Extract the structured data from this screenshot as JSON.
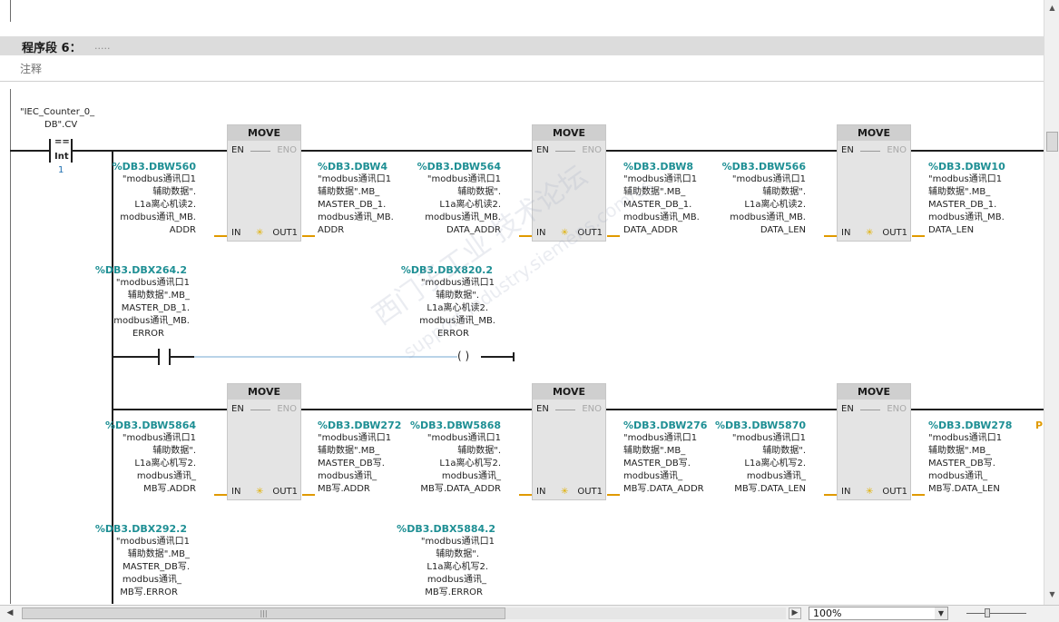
{
  "segment": {
    "title": "程序段 6：",
    "dots": ".....",
    "comment": "注释"
  },
  "contact": {
    "tag_line1": "\"IEC_Counter_0_",
    "tag_line2": "DB\".CV",
    "op": "==",
    "type": "Int",
    "value": "1"
  },
  "move_label": "MOVE",
  "pins": {
    "en": "EN",
    "eno": "ENO",
    "in": "IN",
    "out": "OUT1"
  },
  "row1": [
    {
      "in_addr": "%DB3.DBW560",
      "in_lines": [
        "\"modbus通讯口1",
        "辅助数据\".",
        "L1a离心机读2.",
        "modbus通讯_MB.",
        "ADDR"
      ],
      "out_addr": "%DB3.DBW4",
      "out_lines": [
        "\"modbus通讯口1",
        "辅助数据\".MB_",
        "MASTER_DB_1.",
        "modbus通讯_MB.",
        "ADDR"
      ]
    },
    {
      "in_addr": "%DB3.DBW564",
      "in_lines": [
        "\"modbus通讯口1",
        "辅助数据\".",
        "L1a离心机读2.",
        "modbus通讯_MB.",
        "DATA_ADDR"
      ],
      "out_addr": "%DB3.DBW8",
      "out_lines": [
        "\"modbus通讯口1",
        "辅助数据\".MB_",
        "MASTER_DB_1.",
        "modbus通讯_MB.",
        "DATA_ADDR"
      ]
    },
    {
      "in_addr": "%DB3.DBW566",
      "in_lines": [
        "\"modbus通讯口1",
        "辅助数据\".",
        "L1a离心机读2.",
        "modbus通讯_MB.",
        "DATA_LEN"
      ],
      "out_addr": "%DB3.DBW10",
      "out_lines": [
        "\"modbus通讯口1",
        "辅助数据\".MB_",
        "MASTER_DB_1.",
        "modbus通讯_MB.",
        "DATA_LEN"
      ]
    }
  ],
  "coil_row": {
    "contact_addr": "%DB3.DBX264.2",
    "contact_lines": [
      "\"modbus通讯口1",
      "辅助数据\".MB_",
      "MASTER_DB_1.",
      "modbus通讯_MB.",
      "ERROR"
    ],
    "coil_addr": "%DB3.DBX820.2",
    "coil_lines": [
      "\"modbus通讯口1",
      "辅助数据\".",
      "L1a离心机读2.",
      "modbus通讯_MB.",
      "ERROR"
    ]
  },
  "row2": [
    {
      "in_addr": "%DB3.DBW5864",
      "in_lines": [
        "\"modbus通讯口1",
        "辅助数据\".",
        "L1a离心机写2.",
        "modbus通讯_",
        "MB写.ADDR"
      ],
      "out_addr": "%DB3.DBW272",
      "out_lines": [
        "\"modbus通讯口1",
        "辅助数据\".MB_",
        "MASTER_DB写.",
        "modbus通讯_",
        "MB写.ADDR"
      ]
    },
    {
      "in_addr": "%DB3.DBW5868",
      "in_lines": [
        "\"modbus通讯口1",
        "辅助数据\".",
        "L1a离心机写2.",
        "modbus通讯_",
        "MB写.DATA_ADDR"
      ],
      "out_addr": "%DB3.DBW276",
      "out_lines": [
        "\"modbus通讯口1",
        "辅助数据\".MB_",
        "MASTER_DB写.",
        "modbus通讯_",
        "MB写.DATA_ADDR"
      ]
    },
    {
      "in_addr": "%DB3.DBW5870",
      "in_lines": [
        "\"modbus通讯口1",
        "辅助数据\".",
        "L1a离心机写2.",
        "modbus通讯_",
        "MB写.DATA_LEN"
      ],
      "out_addr": "%DB3.DBW278",
      "out_lines": [
        "\"modbus通讯口1",
        "辅助数据\".MB_",
        "MASTER_DB写.",
        "modbus通讯_",
        "MB写.DATA_LEN"
      ]
    }
  ],
  "row3": {
    "contact_addr": "%DB3.DBX292.2",
    "contact_lines": [
      "\"modbus通讯口1",
      "辅助数据\".MB_",
      "MASTER_DB写.",
      "modbus通讯_",
      "MB写.ERROR"
    ],
    "coil_addr": "%DB3.DBX5884.2",
    "coil_lines": [
      "\"modbus通讯口1",
      "辅助数据\".",
      "L1a离心机写2.",
      "modbus通讯_",
      "MB写.ERROR"
    ]
  },
  "edge_fragment": "P",
  "watermark": {
    "line1": "西门子工业 技术论坛",
    "line2": "support.industry.siemens.com/cs"
  },
  "zoom": {
    "value": "100%"
  },
  "icons": {
    "scroll_up": "up-arrow-icon",
    "scroll_down": "down-arrow-icon",
    "scroll_left": "left-arrow-icon",
    "scroll_right": "right-arrow-icon"
  }
}
